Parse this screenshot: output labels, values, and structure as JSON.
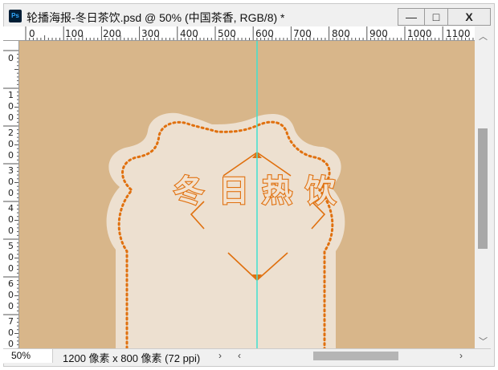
{
  "window": {
    "app_icon": "Ps",
    "title": "轮播海报-冬日茶饮.psd @ 50% (中国茶香, RGB/8) *",
    "minimize_label": "—",
    "maximize_label": "□",
    "close_label": "X"
  },
  "ruler_top": {
    "labels": [
      "0",
      "100",
      "200",
      "300",
      "400",
      "500",
      "600",
      "700",
      "800",
      "900",
      "1000",
      "1100"
    ]
  },
  "ruler_left": {
    "labels": [
      [
        "0"
      ],
      [
        "1",
        "0",
        "0"
      ],
      [
        "2",
        "0",
        "0"
      ],
      [
        "3",
        "0",
        "0"
      ],
      [
        "4",
        "0",
        "0"
      ],
      [
        "5",
        "0",
        "0"
      ],
      [
        "6",
        "0",
        "0"
      ],
      [
        "7",
        "0",
        "0"
      ]
    ]
  },
  "canvas": {
    "headline": [
      "冬",
      "日",
      "热",
      "饮"
    ],
    "background_color": "#d8b68a",
    "frame_color": "#ede0d0",
    "accent_color": "#e0700e",
    "guide_color": "#40e0d0"
  },
  "status": {
    "zoom": "50%",
    "doc_info": "1200 像素 x 800 像素 (72 ppi)",
    "expand_arrow": "›",
    "scroll_left": "‹",
    "scroll_right": "›"
  },
  "scrollbar": {
    "up_arrow": "︿",
    "down_arrow": "﹀"
  }
}
